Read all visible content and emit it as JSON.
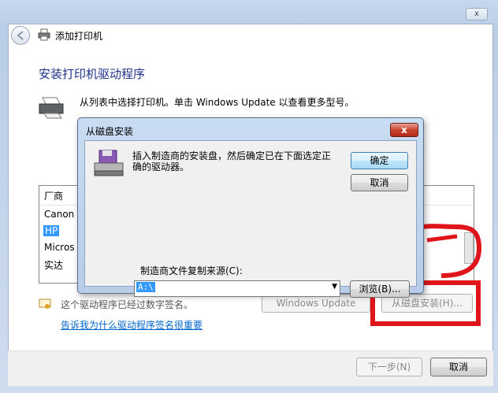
{
  "window": {
    "title": "添加打印机",
    "close_label": "x",
    "heading": "安装打印机驱动程序",
    "description": "从列表中选择打印机。单击 Windows Update 以查看更多型号。",
    "list_header": "厂商",
    "manufacturers": [
      "Canon",
      "HP",
      "Micros",
      "实达"
    ],
    "selected_manufacturer": "HP",
    "signed_text": "这个驱动程序已经过数字签名。",
    "signing_link": "告诉我为什么驱动程序签名很重要",
    "windows_update_button": "Windows Update",
    "have_disk_button": "从磁盘安装(H)...",
    "next_button": "下一步(N)",
    "cancel_button": "取消"
  },
  "dialog": {
    "title": "从磁盘安装",
    "close_label": "x",
    "message": "插入制造商的安装盘，然后确定已在下面选定正确的驱动器。",
    "ok_button": "确定",
    "cancel_button": "取消",
    "source_label": "制造商文件复制来源(C):",
    "source_value": "A:\\",
    "browse_button": "浏览(B)..."
  },
  "colors": {
    "accent_heading": "#1e3287",
    "link": "#0066cc",
    "annotation": "#e0151b",
    "selection": "#3399ff"
  }
}
